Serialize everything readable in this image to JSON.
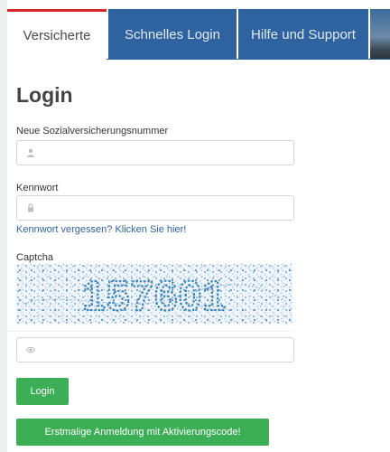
{
  "tabs": {
    "active": "Versicherte",
    "quick_login": "Schnelles Login",
    "help": "Hilfe und Support"
  },
  "form": {
    "title": "Login",
    "ssn_label": "Neue Sozialversicherungsnummer",
    "ssn_value": "",
    "password_label": "Kennwort",
    "password_value": "",
    "forgot_link": "Kennwort vergessen? Klicken Sie hier!",
    "captcha_label": "Captcha",
    "captcha_text": "157601",
    "captcha_value": "",
    "login_button": "Login",
    "activation_button": "Erstmalige Anmeldung mit Aktivierungscode!"
  },
  "icons": {
    "ssn": "user-icon",
    "password": "lock-icon",
    "captcha_input": "eye-icon"
  },
  "colors": {
    "tab_blue": "#2f63a0",
    "active_tab_accent": "#d9262c",
    "button_green": "#3cae55",
    "link_blue": "#2f63a0"
  }
}
